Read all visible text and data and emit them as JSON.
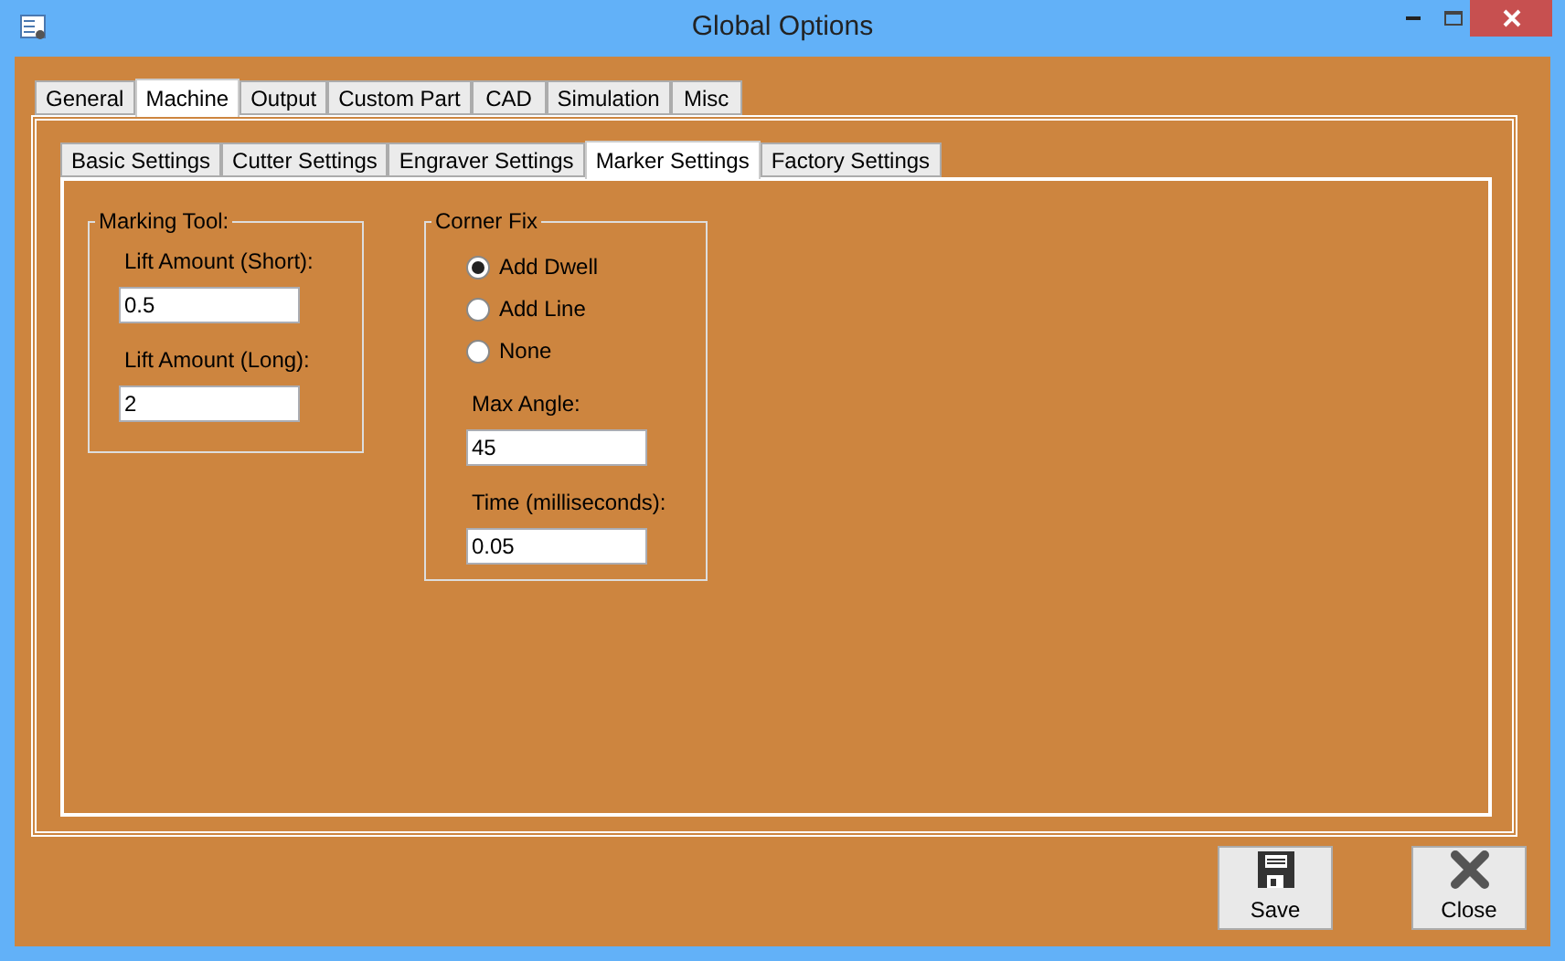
{
  "window": {
    "title": "Global Options"
  },
  "tabs": [
    {
      "label": "General",
      "selected": false
    },
    {
      "label": "Machine",
      "selected": true
    },
    {
      "label": "Output",
      "selected": false
    },
    {
      "label": "Custom Part",
      "selected": false
    },
    {
      "label": "CAD",
      "selected": false
    },
    {
      "label": "Simulation",
      "selected": false
    },
    {
      "label": "Misc",
      "selected": false
    }
  ],
  "subtabs": [
    {
      "label": "Basic Settings",
      "selected": false
    },
    {
      "label": "Cutter Settings",
      "selected": false
    },
    {
      "label": "Engraver Settings",
      "selected": false
    },
    {
      "label": "Marker Settings",
      "selected": true
    },
    {
      "label": "Factory Settings",
      "selected": false
    }
  ],
  "marking_tool": {
    "title": "Marking Tool:",
    "fields": [
      {
        "label": "Lift Amount (Short):",
        "value": "0.5"
      },
      {
        "label": "Lift Amount (Long):",
        "value": "2"
      }
    ]
  },
  "corner_fix": {
    "title": "Corner Fix",
    "options": [
      {
        "label": "Add Dwell",
        "selected": true
      },
      {
        "label": "Add Line",
        "selected": false
      },
      {
        "label": "None",
        "selected": false
      }
    ],
    "fields": [
      {
        "label": "Max Angle:",
        "value": "45"
      },
      {
        "label": "Time (milliseconds):",
        "value": "0.05"
      }
    ]
  },
  "buttons": [
    {
      "kind": "save",
      "label": "Save"
    },
    {
      "kind": "close",
      "label": "Close"
    }
  ]
}
